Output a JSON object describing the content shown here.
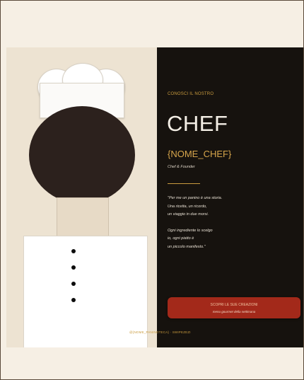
{
  "hero": {
    "kicker": "CONOSCI IL NOSTRO",
    "title": "CHEF",
    "name": "{NOME_CHEF}",
    "role": "Chef & Founder"
  },
  "quote": {
    "lines": [
      "\"Per me un panino è una storia.",
      "Una ricetta, un ricordo,",
      "un viaggio in due morsi.",
      "",
      "Ogni ingrediente lo scelgo",
      "io, ogni piatto è",
      "un piccolo manifesto.\""
    ]
  },
  "cta": {
    "label": "SCOPRI LE SUE CREAZIONI",
    "sublabel": "menu gourmet della settimana"
  },
  "footer": {
    "handle": "@{NOME_PANINOTECA} · SWIPEZEZI"
  },
  "colors": {
    "accent": "#c99b3e",
    "cta": "#a3291a",
    "dark_panel": "#16120e",
    "light_panel": "#ede3d2"
  },
  "icons": [
    "chef-hat-icon"
  ]
}
